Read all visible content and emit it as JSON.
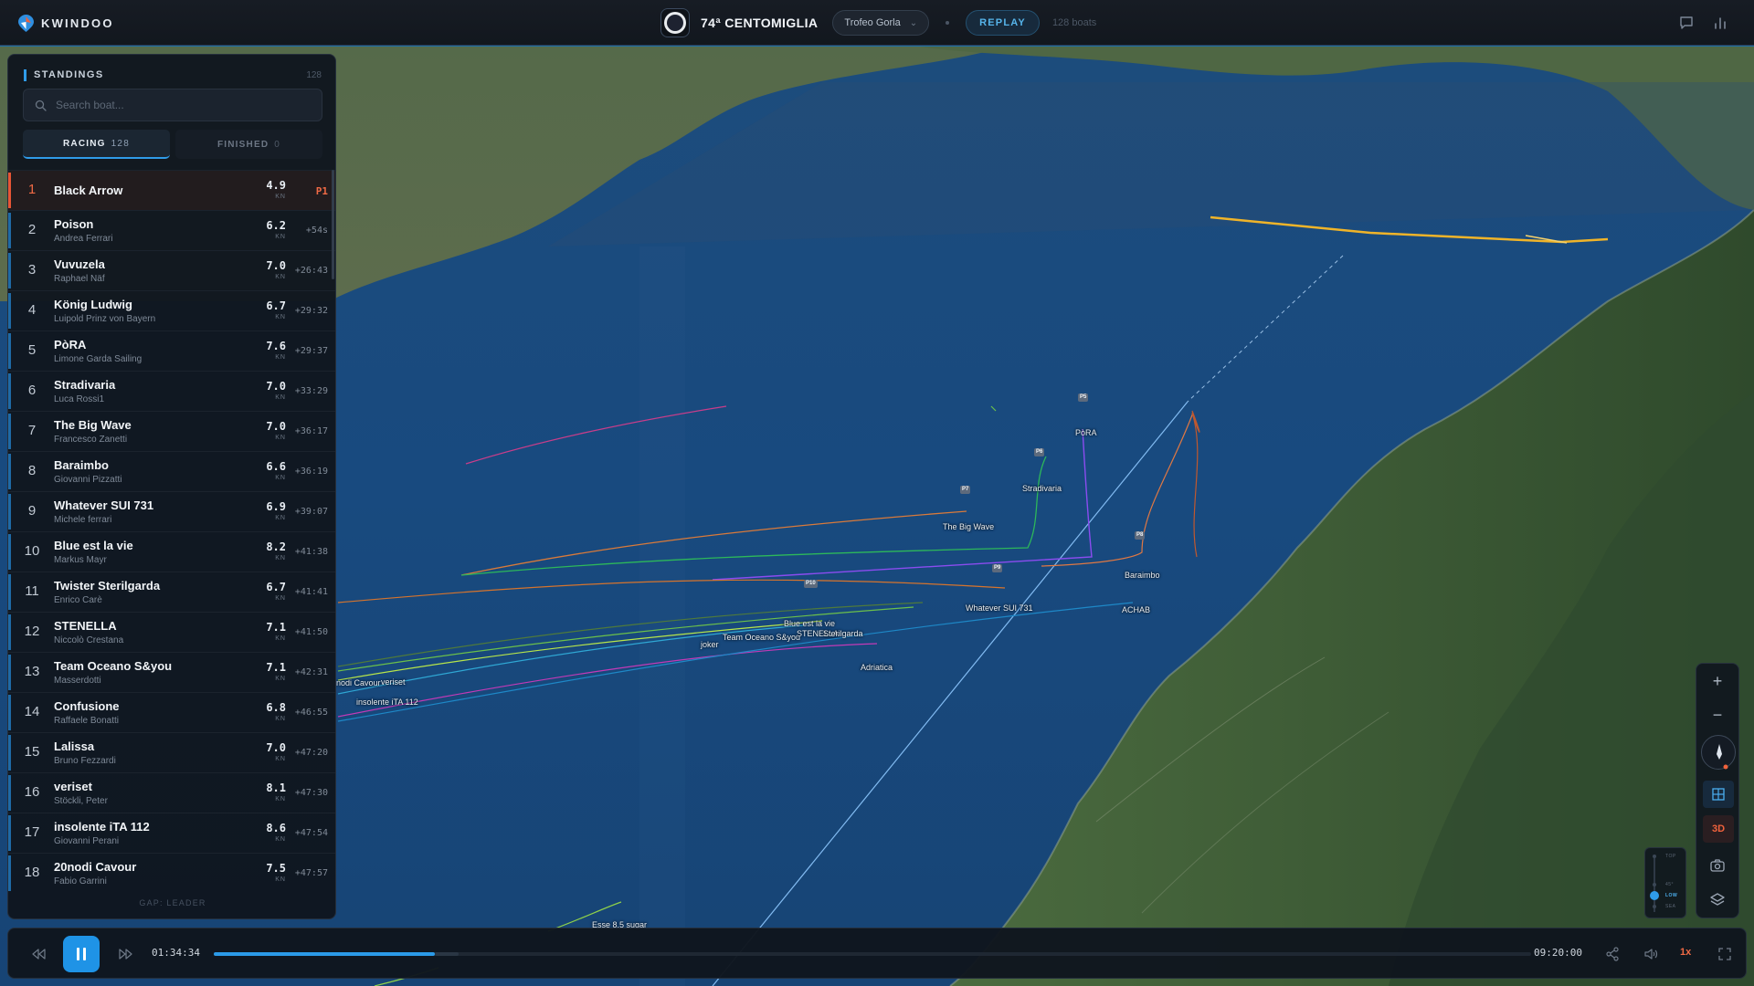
{
  "app": {
    "brand": "KWINDOO"
  },
  "header": {
    "event_title": "74ª CENTOMIGLIA",
    "class_selector": "Trofeo Gorla",
    "mode_button": "REPLAY",
    "boat_count": "128 boats",
    "right_icons": [
      "chat-icon",
      "stats-icon"
    ]
  },
  "standings": {
    "title": "STANDINGS",
    "count": "128",
    "search_placeholder": "Search boat...",
    "tabs": [
      {
        "label": "RACING",
        "count": "128",
        "active": true
      },
      {
        "label": "FINISHED",
        "count": "0",
        "active": false
      }
    ],
    "speed_unit": "KN",
    "rows": [
      {
        "pos": "1",
        "name": "Black Arrow",
        "skipper": "",
        "speed": "4.9",
        "gap": "P1"
      },
      {
        "pos": "2",
        "name": "Poison",
        "skipper": "Andrea Ferrari",
        "speed": "6.2",
        "gap": "+54s"
      },
      {
        "pos": "3",
        "name": "Vuvuzela",
        "skipper": "Raphael Näf",
        "speed": "7.0",
        "gap": "+26:43"
      },
      {
        "pos": "4",
        "name": "König Ludwig",
        "skipper": "Luipold Prinz von Bayern",
        "speed": "6.7",
        "gap": "+29:32"
      },
      {
        "pos": "5",
        "name": "PòRA",
        "skipper": "Limone Garda Sailing",
        "speed": "7.6",
        "gap": "+29:37"
      },
      {
        "pos": "6",
        "name": "Stradivaria",
        "skipper": "Luca Rossi1",
        "speed": "7.0",
        "gap": "+33:29"
      },
      {
        "pos": "7",
        "name": "The Big Wave",
        "skipper": "Francesco Zanetti",
        "speed": "7.0",
        "gap": "+36:17"
      },
      {
        "pos": "8",
        "name": "Baraimbo",
        "skipper": "Giovanni Pizzatti",
        "speed": "6.6",
        "gap": "+36:19"
      },
      {
        "pos": "9",
        "name": "Whatever SUI 731",
        "skipper": "Michele ferrari",
        "speed": "6.9",
        "gap": "+39:07"
      },
      {
        "pos": "10",
        "name": "Blue est la vie",
        "skipper": "Markus Mayr",
        "speed": "8.2",
        "gap": "+41:38"
      },
      {
        "pos": "11",
        "name": "Twister Sterilgarda",
        "skipper": "Enrico Carè",
        "speed": "6.7",
        "gap": "+41:41"
      },
      {
        "pos": "12",
        "name": "STENELLA",
        "skipper": "Niccolò Crestana",
        "speed": "7.1",
        "gap": "+41:50"
      },
      {
        "pos": "13",
        "name": "Team Oceano S&you",
        "skipper": "Masserdotti",
        "speed": "7.1",
        "gap": "+42:31"
      },
      {
        "pos": "14",
        "name": "Confusione",
        "skipper": "Raffaele Bonatti",
        "speed": "6.8",
        "gap": "+46:55"
      },
      {
        "pos": "15",
        "name": "Lalissa",
        "skipper": "Bruno Fezzardi",
        "speed": "7.0",
        "gap": "+47:20"
      },
      {
        "pos": "16",
        "name": "veriset",
        "skipper": "Stöckli, Peter",
        "speed": "8.1",
        "gap": "+47:30"
      },
      {
        "pos": "17",
        "name": "insolente iTA 112",
        "skipper": "Giovanni Perani",
        "speed": "8.6",
        "gap": "+47:54"
      },
      {
        "pos": "18",
        "name": "20nodi Cavour",
        "skipper": "Fabio Garrini",
        "speed": "7.5",
        "gap": "+47:57"
      }
    ],
    "footer": "GAP: LEADER"
  },
  "map": {
    "marks": [
      "P5",
      "P6",
      "P7",
      "P8",
      "P9",
      "P10"
    ],
    "boat_labels": [
      "PòRA",
      "Stradivaria",
      "The Big Wave",
      "Baraimbo",
      "Whatever SUI 731",
      "ACHAB",
      "Blue est la vie",
      "STENELLA",
      "Sterilgarda",
      "Team Oceano S&you",
      "joker",
      "Adriatica",
      "nodi Cavour",
      "veriset",
      "insolente iTA 112",
      "Esse 8.5 sugar"
    ],
    "colors": {
      "water": "#1a4d80",
      "land": "#3f5a36",
      "leader_track": "#f0b429",
      "course_line": "#9fd0ff"
    }
  },
  "controls": {
    "zoom_in": "+",
    "zoom_out": "−",
    "view_3d": "3D",
    "altitude_levels": [
      "TOP",
      "45°",
      "LOW",
      "SEA"
    ],
    "altitude_selected": "LOW"
  },
  "playback": {
    "current_time": "01:34:34",
    "end_time": "09:20:00",
    "progress": 0.168,
    "buffered": 0.186,
    "speed": "1x"
  }
}
